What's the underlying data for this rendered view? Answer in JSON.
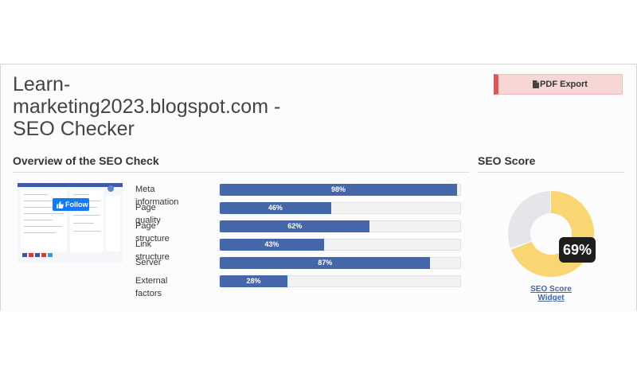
{
  "header": {
    "title_line1": "Learn-",
    "title_line2": "marketing2023.blogspot.com -",
    "title_line3": "SEO Checker",
    "pdf_export_label": "PDF Export"
  },
  "overview": {
    "title": "Overview of the SEO Check",
    "follow_label": "Follow",
    "metrics": [
      {
        "label": "Meta information",
        "value": 98,
        "value_text": "98%"
      },
      {
        "label": "Page quality",
        "value": 46,
        "value_text": "46%"
      },
      {
        "label": "Page structure",
        "value": 62,
        "value_text": "62%"
      },
      {
        "label": "Link structure",
        "value": 43,
        "value_text": "43%"
      },
      {
        "label": "Server",
        "value": 87,
        "value_text": "87%"
      },
      {
        "label": "External factors",
        "value": 28,
        "value_text": "28%"
      }
    ]
  },
  "score": {
    "title": "SEO Score",
    "value": 69,
    "value_text": "69%",
    "widget_link": "SEO Score Widget",
    "filled_color": "#fad673",
    "empty_color": "#e6e6ea"
  },
  "colors": {
    "bar_fill": "#4467a9",
    "pdf_accent": "#e05454"
  }
}
